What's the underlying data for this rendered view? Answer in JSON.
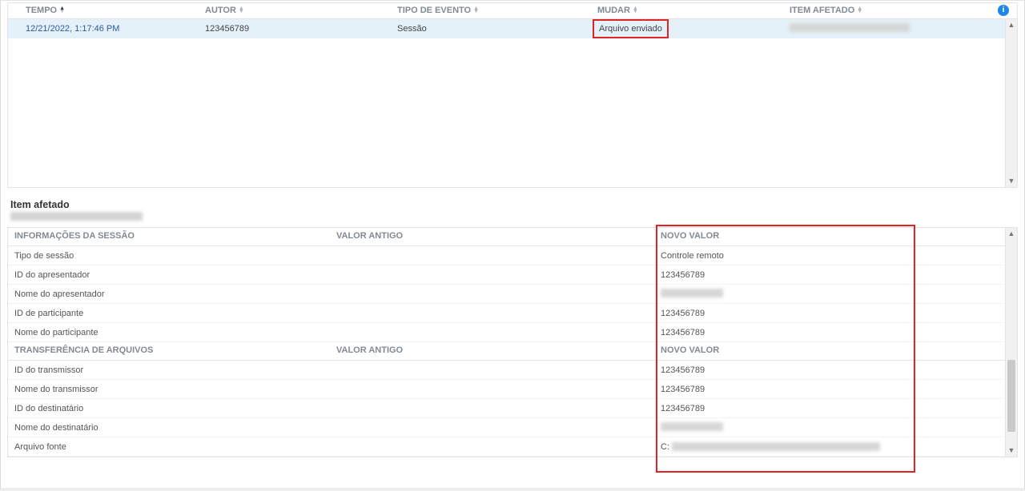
{
  "table": {
    "headers": {
      "tempo": "TEMPO",
      "autor": "AUTOR",
      "tipo": "TIPO DE EVENTO",
      "mudar": "MUDAR",
      "item": "ITEM AFETADO"
    },
    "row": {
      "tempo": "12/21/2022, 1:17:46 PM",
      "autor": "123456789",
      "tipo": "Sessão",
      "mudar": "Arquivo enviado"
    }
  },
  "section_title": "Item afetado",
  "groups": [
    {
      "title": "INFORMAÇÕES DA SESSÃO",
      "col_old": "VALOR ANTIGO",
      "col_new": "NOVO VALOR",
      "rows": [
        {
          "label": "Tipo de sessão",
          "newv": "Controle remoto"
        },
        {
          "label": "ID do apresentador",
          "newv": "123456789"
        },
        {
          "label": "Nome do apresentador",
          "newv": "",
          "blur_w": 78
        },
        {
          "label": "ID de participante",
          "newv": "123456789"
        },
        {
          "label": "Nome do participante",
          "newv": "123456789"
        }
      ]
    },
    {
      "title": "TRANSFERÊNCIA DE ARQUIVOS",
      "col_old": "VALOR ANTIGO",
      "col_new": "NOVO VALOR",
      "rows": [
        {
          "label": "ID do transmissor",
          "newv": "123456789"
        },
        {
          "label": "Nome do transmissor",
          "newv": "123456789"
        },
        {
          "label": "ID do destinatário",
          "newv": "123456789"
        },
        {
          "label": "Nome do destinatário",
          "newv": "",
          "blur_w": 78
        },
        {
          "label": "Arquivo fonte",
          "newv": "C:",
          "blur_w": 260,
          "prefix": "C:"
        }
      ]
    }
  ]
}
